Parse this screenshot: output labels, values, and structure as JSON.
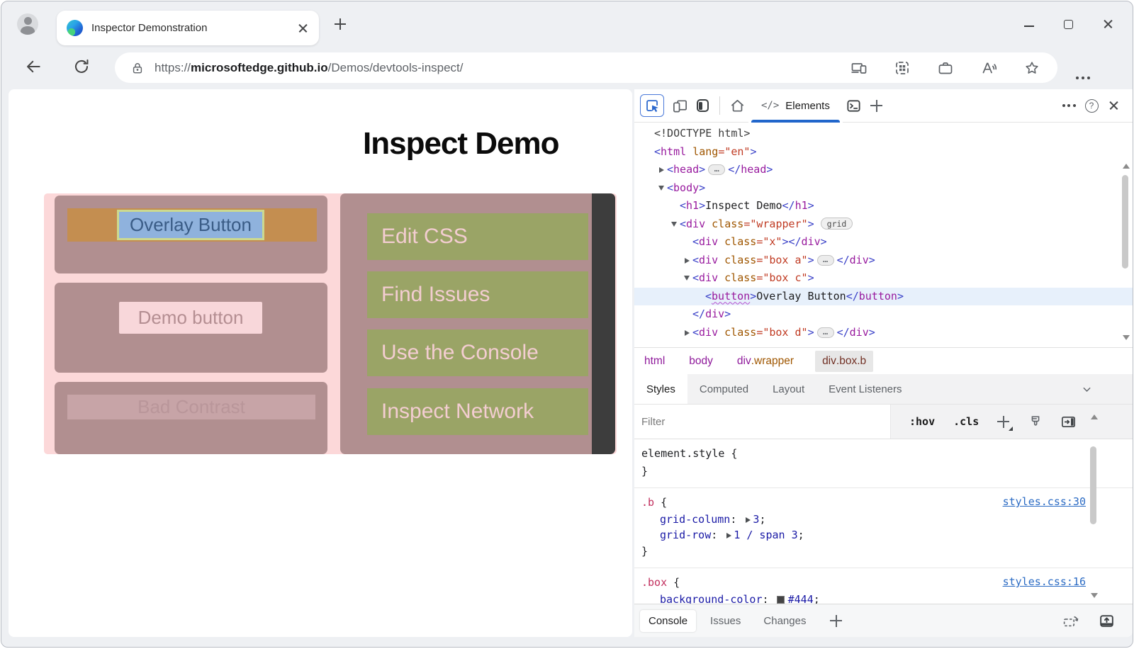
{
  "browser": {
    "tab_title": "Inspector Demonstration",
    "url": {
      "scheme": "https://",
      "domain": "microsoftedge.github.io",
      "path": "/Demos/devtools-inspect/"
    }
  },
  "page": {
    "heading": "Inspect Demo",
    "overlay_button": "Overlay Button",
    "demo_button": "Demo button",
    "bad_contrast_button": "Bad Contrast",
    "links": [
      "Edit CSS",
      "Find Issues",
      "Use the Console",
      "Inspect Network"
    ],
    "colors": {
      "wrapper_pink": "#fcd8d9",
      "box_mauve": "#b18f90",
      "olive_green": "#9aa466",
      "link_text_pink": "#f3cdd1",
      "band_orange": "#c48e50",
      "overlay_blue": "#8fb2dd",
      "overlay_outline": "#ccd98f",
      "dark_bar": "#3d3d3d"
    }
  },
  "devtools": {
    "elements_glyph": "</>",
    "elements_tab": "Elements",
    "accent_blue": "#2166cb",
    "code_colors": {
      "punctuation": "#3a41c8",
      "tag": "#981a9e",
      "attribute": "#9f5600",
      "value": "#c03b23"
    },
    "dom_tree": [
      {
        "lvl": 0,
        "toks": [
          [
            "<!DOCTYPE html>",
            "d"
          ]
        ]
      },
      {
        "lvl": 0,
        "toks": [
          [
            "<",
            "p"
          ],
          [
            "html",
            "t"
          ],
          [
            " ",
            "x"
          ],
          [
            "lang",
            "a"
          ],
          [
            "=",
            "v"
          ],
          [
            "\"en\"",
            "v"
          ],
          [
            ">",
            "p"
          ]
        ]
      },
      {
        "lvl": 1,
        "arrow": "r",
        "toks": [
          [
            "<",
            "p"
          ],
          [
            "head",
            "t"
          ],
          [
            ">",
            "p"
          ],
          [
            "…",
            "pill"
          ],
          [
            "</",
            "p"
          ],
          [
            "head",
            "t"
          ],
          [
            ">",
            "p"
          ]
        ]
      },
      {
        "lvl": 1,
        "arrow": "d",
        "toks": [
          [
            "<",
            "p"
          ],
          [
            "body",
            "t"
          ],
          [
            ">",
            "p"
          ]
        ]
      },
      {
        "lvl": 2,
        "toks": [
          [
            "<",
            "p"
          ],
          [
            "h1",
            "t"
          ],
          [
            ">",
            "p"
          ],
          [
            "Inspect Demo",
            "x"
          ],
          [
            "</",
            "p"
          ],
          [
            "h1",
            "t"
          ],
          [
            ">",
            "p"
          ]
        ]
      },
      {
        "lvl": 2,
        "arrow": "d",
        "badge": "grid",
        "toks": [
          [
            "<",
            "p"
          ],
          [
            "div",
            "t"
          ],
          [
            " ",
            "x"
          ],
          [
            "class",
            "a"
          ],
          [
            "=",
            "v"
          ],
          [
            "\"wrapper\"",
            "v"
          ],
          [
            ">",
            "p"
          ]
        ]
      },
      {
        "lvl": 3,
        "toks": [
          [
            "<",
            "p"
          ],
          [
            "div",
            "t"
          ],
          [
            " ",
            "x"
          ],
          [
            "class",
            "a"
          ],
          [
            "=",
            "v"
          ],
          [
            "\"x\"",
            "v"
          ],
          [
            ">",
            "p"
          ],
          [
            "</",
            "p"
          ],
          [
            "div",
            "t"
          ],
          [
            ">",
            "p"
          ]
        ]
      },
      {
        "lvl": 3,
        "arrow": "r",
        "toks": [
          [
            "<",
            "p"
          ],
          [
            "div",
            "t"
          ],
          [
            " ",
            "x"
          ],
          [
            "class",
            "a"
          ],
          [
            "=",
            "v"
          ],
          [
            "\"box a\"",
            "v"
          ],
          [
            ">",
            "p"
          ],
          [
            "…",
            "pill"
          ],
          [
            "</",
            "p"
          ],
          [
            "div",
            "t"
          ],
          [
            ">",
            "p"
          ]
        ]
      },
      {
        "lvl": 3,
        "arrow": "d",
        "toks": [
          [
            "<",
            "p"
          ],
          [
            "div",
            "t"
          ],
          [
            " ",
            "x"
          ],
          [
            "class",
            "a"
          ],
          [
            "=",
            "v"
          ],
          [
            "\"box c\"",
            "v"
          ],
          [
            ">",
            "p"
          ]
        ]
      },
      {
        "lvl": 4,
        "sel": true,
        "toks": [
          [
            "<",
            "p"
          ],
          [
            "button",
            "t squig"
          ],
          [
            ">",
            "p"
          ],
          [
            "Overlay Button",
            "x"
          ],
          [
            "</",
            "p"
          ],
          [
            "button",
            "t"
          ],
          [
            ">",
            "p"
          ]
        ]
      },
      {
        "lvl": 3,
        "toks": [
          [
            "</",
            "p"
          ],
          [
            "div",
            "t"
          ],
          [
            ">",
            "p"
          ]
        ]
      },
      {
        "lvl": 3,
        "arrow": "r",
        "toks": [
          [
            "<",
            "p"
          ],
          [
            "div",
            "t"
          ],
          [
            " ",
            "x"
          ],
          [
            "class",
            "a"
          ],
          [
            "=",
            "v"
          ],
          [
            "\"box d\"",
            "v"
          ],
          [
            ">",
            "p"
          ],
          [
            "…",
            "pill"
          ],
          [
            "</",
            "p"
          ],
          [
            "div",
            "t"
          ],
          [
            ">",
            "p"
          ]
        ]
      }
    ],
    "breadcrumbs": [
      {
        "parts": [
          {
            "t": "html",
            "c": "t"
          }
        ]
      },
      {
        "parts": [
          {
            "t": "body",
            "c": "t"
          }
        ]
      },
      {
        "parts": [
          {
            "t": "div",
            "c": "t"
          },
          {
            "t": ".wrapper",
            "c": "c"
          }
        ]
      },
      {
        "parts": [
          {
            "t": "div",
            "c": "t"
          },
          {
            "t": ".box.b",
            "c": "c"
          }
        ],
        "active": true
      }
    ],
    "style_tabs": [
      {
        "label": "Styles",
        "active": true
      },
      {
        "label": "Computed"
      },
      {
        "label": "Layout"
      },
      {
        "label": "Event Listeners"
      }
    ],
    "filter_placeholder": "Filter",
    "toggles": [
      ":hov",
      ".cls"
    ],
    "styles_rules": [
      {
        "selector": "element.style",
        "plain": true,
        "props": []
      },
      {
        "selector": ".b",
        "link": "styles.css:30",
        "props": [
          {
            "name": "grid-column",
            "value": "3",
            "expand": true
          },
          {
            "name": "grid-row",
            "value": "1 / span 3",
            "expand": true
          }
        ]
      },
      {
        "selector": ".box",
        "link": "styles.css:16",
        "props": [
          {
            "name": "background-color",
            "value": "#444",
            "swatch": "#444"
          }
        ]
      }
    ],
    "drawer_tabs": [
      {
        "label": "Console",
        "active": true
      },
      {
        "label": "Issues"
      },
      {
        "label": "Changes"
      }
    ],
    "icons": {
      "toolbar": [
        "inspect-icon",
        "device-emulation-icon",
        "dock-side-icon",
        "home-icon",
        "console-drawer-icon",
        "add-tab-icon",
        "more-icon",
        "help-icon",
        "close-icon"
      ],
      "filter_row": [
        "add-style-rule-icon",
        "paintbrush-icon",
        "sidebar-toggle-icon"
      ],
      "drawer": [
        "rotate-device-icon",
        "open-panel-icon"
      ]
    }
  }
}
